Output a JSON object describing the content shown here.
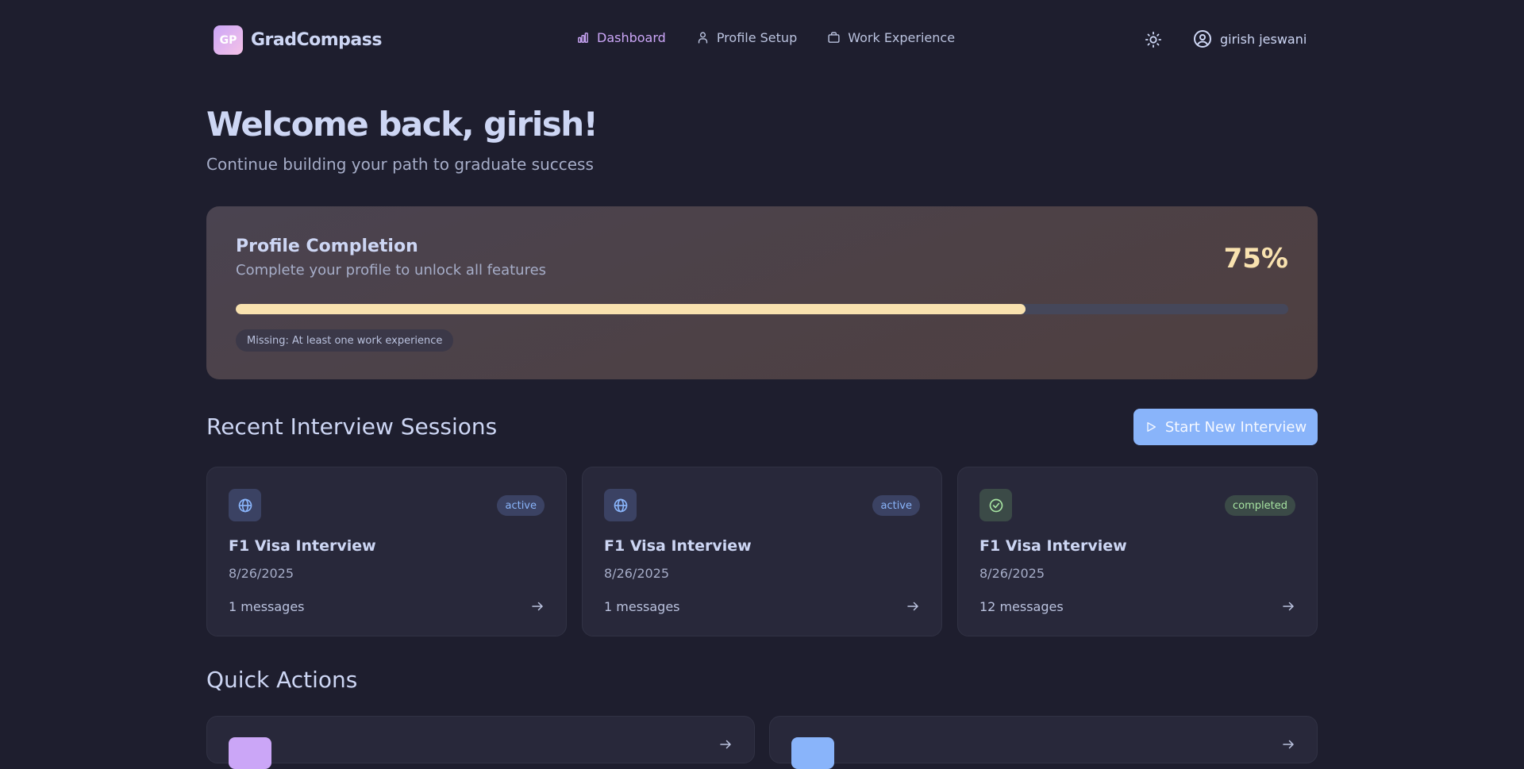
{
  "brand": {
    "badge": "GP",
    "name": "GradCompass"
  },
  "nav": {
    "items": [
      {
        "label": "Dashboard",
        "icon": "bar-chart-icon",
        "active": true
      },
      {
        "label": "Profile Setup",
        "icon": "user-icon",
        "active": false
      },
      {
        "label": "Work Experience",
        "icon": "briefcase-icon",
        "active": false
      }
    ],
    "theme_icon": "sun-icon",
    "user_name": "girish jeswani"
  },
  "hero": {
    "title": "Welcome back, girish!",
    "subtitle": "Continue building your path to graduate success"
  },
  "profile_completion": {
    "title": "Profile Completion",
    "subtitle": "Complete your profile to unlock all features",
    "percent_label": "75%",
    "progress": 0.75,
    "missing": "Missing: At least one work experience"
  },
  "sessions": {
    "title": "Recent Interview Sessions",
    "start_button": "Start New Interview",
    "items": [
      {
        "title": "F1 Visa Interview",
        "date": "8/26/2025",
        "messages": "1 messages",
        "status": "active",
        "icon": "globe-icon"
      },
      {
        "title": "F1 Visa Interview",
        "date": "8/26/2025",
        "messages": "1 messages",
        "status": "active",
        "icon": "globe-icon"
      },
      {
        "title": "F1 Visa Interview",
        "date": "8/26/2025",
        "messages": "12 messages",
        "status": "completed",
        "icon": "check-circle-icon"
      }
    ]
  },
  "quick_actions": {
    "title": "Quick Actions"
  },
  "colors": {
    "background": "#1e1e2e",
    "accent": "#cba6f7",
    "progress": "#f9e2af",
    "button": "#89b4fa",
    "success": "#a6e3a1"
  }
}
